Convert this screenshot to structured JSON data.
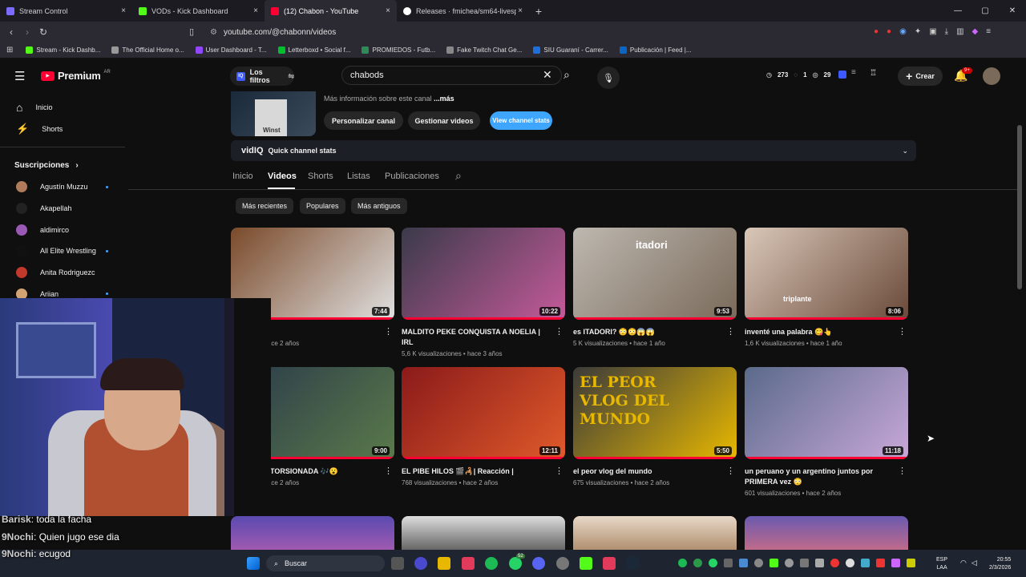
{
  "browser": {
    "tabs": [
      {
        "label": "Stream Control",
        "color": "#7b6cff"
      },
      {
        "label": "VODs - Kick Dashboard",
        "color": "#53fc18"
      },
      {
        "label": "(12) Chabon - YouTube",
        "color": "#ff0033"
      },
      {
        "label": "Releases · fmichea/sm64-livesplit-aut",
        "color": "#ffffff"
      }
    ],
    "url": "youtube.com/@chabonn/videos",
    "bookmarks": [
      "Stream - Kick Dashb...",
      "The Official Home o...",
      "User Dashboard - T...",
      "Letterboxd • Social f...",
      "PROMIEDOS - Futb...",
      "Fake Twitch Chat Ge...",
      "SIU Guaraní - Carrer...",
      "Publicación | Feed |..."
    ]
  },
  "yt": {
    "logo": "Premium",
    "region": "AR",
    "filters_label": "Los filtros",
    "search_value": "chabods",
    "stats": {
      "a": "273",
      "b": "1",
      "c": "29"
    },
    "create_label": "Crear",
    "notif_badge": "9+",
    "nav": {
      "home": "Inicio",
      "shorts": "Shorts"
    },
    "subs_title": "Suscripciones",
    "subs": [
      {
        "name": "Agustín Muzzu",
        "color": "#b07b5a",
        "dot": true
      },
      {
        "name": "Akapellah",
        "color": "#222",
        "dot": false
      },
      {
        "name": "aldimirco",
        "color": "#9b59b6",
        "dot": false
      },
      {
        "name": "All Elite Wrestling",
        "color": "#111",
        "dot": true
      },
      {
        "name": "Anita Rodriguezc",
        "color": "#c0392b",
        "dot": false
      },
      {
        "name": "Ariian",
        "color": "#d4a373",
        "dot": true
      }
    ],
    "channel": {
      "more_info": "Más información sobre este canal",
      "more": "...más",
      "customize": "Personalizar canal",
      "manage": "Gestionar videos",
      "stats_btn": "View channel stats"
    },
    "vidiq": {
      "logo": "vidIQ",
      "label": "Quick channel stats"
    },
    "tabs": [
      "Inicio",
      "Videos",
      "Shorts",
      "Listas",
      "Publicaciones"
    ],
    "chips": [
      "Más recientes",
      "Populares",
      "Más antiguos"
    ],
    "videos": [
      {
        "title": "... luna ☠️",
        "meta": "...aciones • hace 2 años",
        "dur": "7:44",
        "c1": "#7a4a2a",
        "c2": "#e0e0e0"
      },
      {
        "title": "MALDITO PEKE CONQUISTA A NOELIA | IRL",
        "meta": "5,6 K visualizaciones • hace 3 años",
        "dur": "10:22",
        "c1": "#3a3a4a",
        "c2": "#c45a9a"
      },
      {
        "title": "es ITADORI? 😳😳😱😱",
        "meta": "5 K visualizaciones • hace 1 año",
        "dur": "9:53",
        "c1": "#bdb8b0",
        "c2": "#7a6a5a"
      },
      {
        "title": "inventé una palabra 😋👆",
        "meta": "1,6 K visualizaciones • hace 1 año",
        "dur": "8:06",
        "c1": "#d9c7b8",
        "c2": "#6a4a3a"
      },
      {
        "title": "...nción DISTORSIONADA 🎶😮",
        "meta": "...aciones • hace 2 años",
        "dur": "9:00",
        "c1": "#2a3a4a",
        "c2": "#5a7a4a"
      },
      {
        "title": "EL PIBE HILOS 🎬🦂| Reacción |",
        "meta": "768 visualizaciones • hace 2 años",
        "dur": "12:11",
        "c1": "#8a1a1a",
        "c2": "#e05a2a"
      },
      {
        "title": "el peor vlog del mundo",
        "meta": "675 visualizaciones • hace 2 años",
        "dur": "5:50",
        "c1": "#3a3a3a",
        "c2": "#e8b800"
      },
      {
        "title": "un peruano y un argentino juntos por PRIMERA vez 😳",
        "meta": "601 visualizaciones • hace 2 años",
        "dur": "11:18",
        "c1": "#5a6a8a",
        "c2": "#c8a8d8"
      }
    ],
    "thumb_text": {
      "itadori": "itadori",
      "triplante": "triplante",
      "vlog": "EL PEOR VLOG DEL MUNDO"
    }
  },
  "chat": [
    {
      "user": "Barisk",
      "msg": "toda la facha"
    },
    {
      "user": "9Nochi",
      "msg": "Quien jugo ese dia"
    },
    {
      "user": "9Nochi",
      "msg": "ecugod"
    }
  ],
  "taskbar": {
    "search": "Buscar",
    "lang": "ESP",
    "lang2": "LAA",
    "time": "20:55",
    "date": "2/3/2026",
    "badge": "52"
  }
}
